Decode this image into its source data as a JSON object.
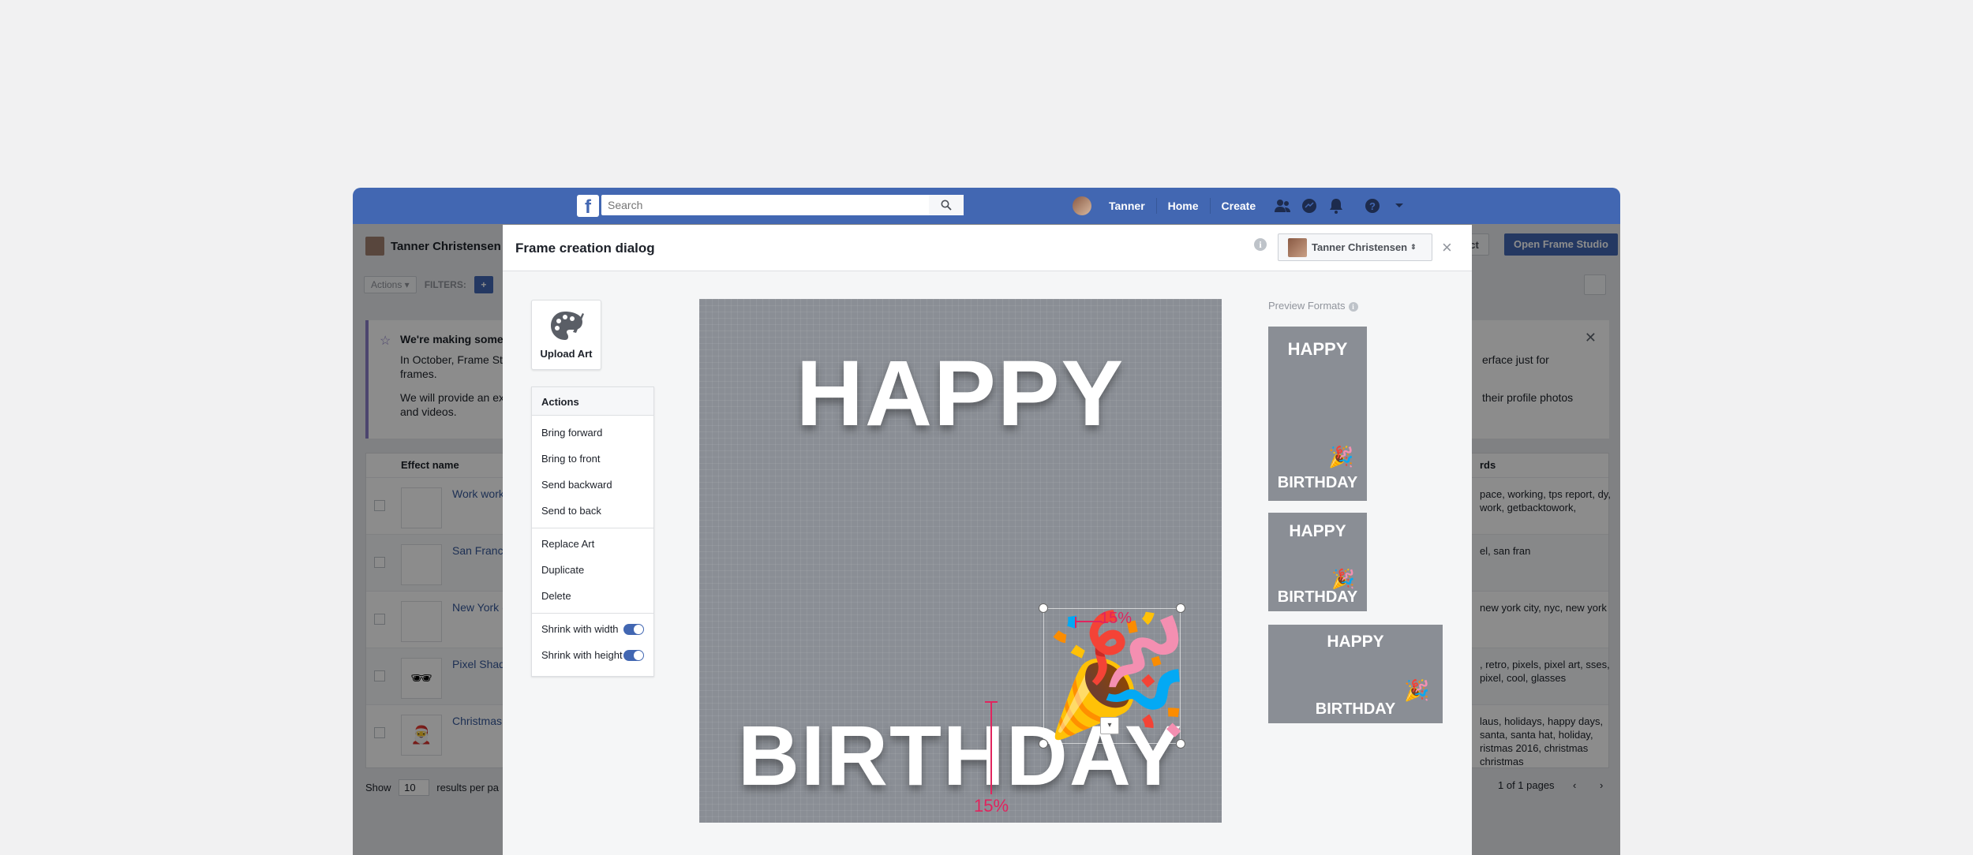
{
  "topbar": {
    "logo": "f",
    "search_placeholder": "Search",
    "user_name": "Tanner",
    "home": "Home",
    "create": "Create"
  },
  "background": {
    "page_owner": "Tanner Christensen",
    "select_button": "ect",
    "open_frame_studio": "Open Frame Studio",
    "actions": "Actions ▾",
    "filters": "FILTERS:",
    "filter_add": "+",
    "notice": {
      "title": "We're making some",
      "p1_line1": "In October, Frame St",
      "p1_line2": "frames.",
      "p2_line1": "We will provide an ex",
      "p2_line2": "and videos.",
      "right1": "erface just for",
      "right2": "their profile photos"
    },
    "table": {
      "col_effect": "Effect name",
      "col_keywords": "rds",
      "rows": [
        {
          "name": "Work work",
          "kw": "pace, working, tps report, dy, work, getbacktowork,",
          "icon": ""
        },
        {
          "name": "San Franci",
          "kw": "el, san fran",
          "icon": ""
        },
        {
          "name": "New York (",
          "kw": "new york city, nyc, new york",
          "icon": ""
        },
        {
          "name": "Pixel Shad",
          "kw": ", retro, pixels, pixel art, sses, pixel, cool, glasses",
          "icon": "🕶"
        },
        {
          "name": "Christmas",
          "kw": "laus, holidays, happy days, santa, santa hat, holiday, ristmas 2016, christmas christmas",
          "icon": "🎅"
        }
      ]
    },
    "pager": {
      "show": "Show",
      "per_page": "10",
      "results": "results per pa",
      "pages": "1 of 1 pages"
    }
  },
  "dialog": {
    "title": "Frame creation dialog",
    "profile": "Tanner Christensen",
    "upload_label": "Upload Art",
    "actions_title": "Actions",
    "actions": [
      "Bring forward",
      "Bring to front",
      "Send backward",
      "Send to back"
    ],
    "actions2": [
      "Replace Art",
      "Duplicate",
      "Delete"
    ],
    "toggles": [
      {
        "label": "Shrink with width",
        "on": true
      },
      {
        "label": "Shrink with height",
        "on": true
      }
    ],
    "canvas": {
      "line1": "HAPPY",
      "line2": "BIRTHDAY",
      "sticker": "🎉",
      "guide_bottom": "15%",
      "guide_top": "15%"
    },
    "preview_title": "Preview Formats",
    "preview_text1": "HAPPY",
    "preview_text2": "BIRTHDAY",
    "colors": {
      "brand": "#4267b2",
      "guide": "#e0245e",
      "canvas": "#8a8e95"
    }
  }
}
